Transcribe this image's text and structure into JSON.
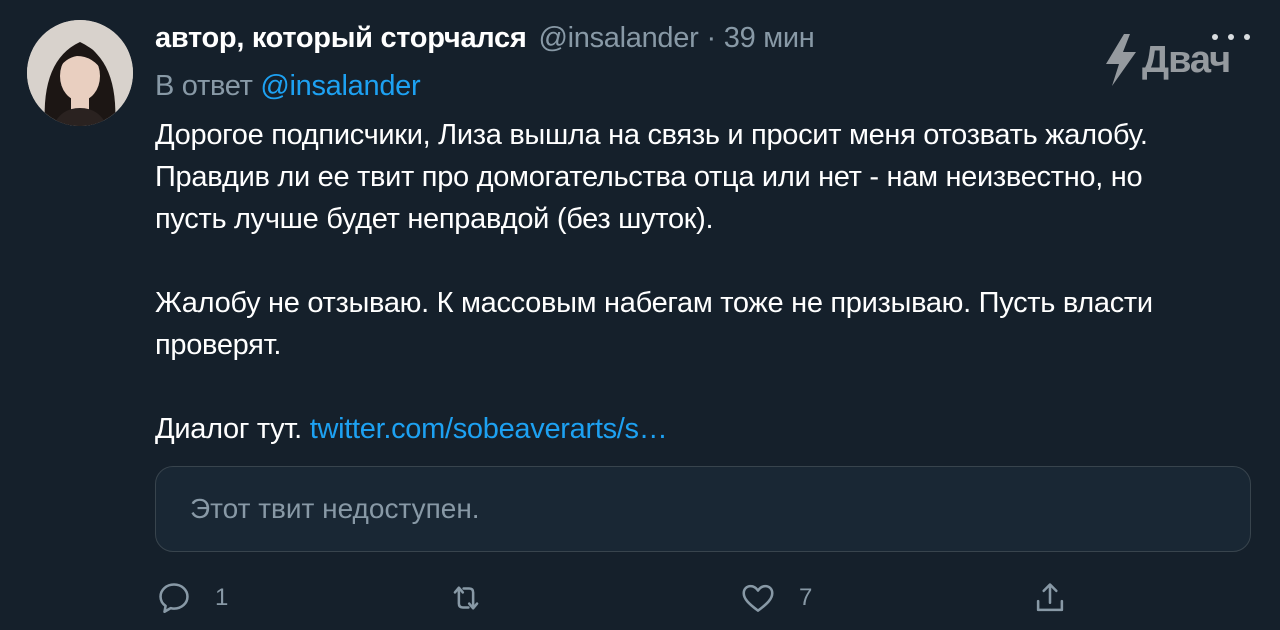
{
  "tweet": {
    "display_name": "автор, который сторчался",
    "handle": "@insalander",
    "separator": "·",
    "time": "39 мин",
    "reply_prefix": "В ответ",
    "reply_handle": "@insalander",
    "paragraphs": [
      "Дорогое подписчики, Лиза вышла на связь и просит меня отозвать жалобу. Правдив ли ее твит про домогательства отца или нет - нам неизвестно, но пусть лучше будет неправдой (без шуток).",
      "Жалобу не отзываю. К массовым набегам тоже не призываю. Пусть власти проверят."
    ],
    "last_line_prefix": "Диалог тут.",
    "link_text": "twitter.com/sobeaverarts/s…",
    "quoted_unavailable": "Этот твит недоступен."
  },
  "actions": {
    "reply_count": "1",
    "retweet_count": "",
    "like_count": "7"
  },
  "watermark": {
    "text": "Двач"
  },
  "colors": {
    "background": "#15202b",
    "secondary_text": "#8899a6",
    "link": "#1da1f2",
    "border": "#38444d"
  }
}
